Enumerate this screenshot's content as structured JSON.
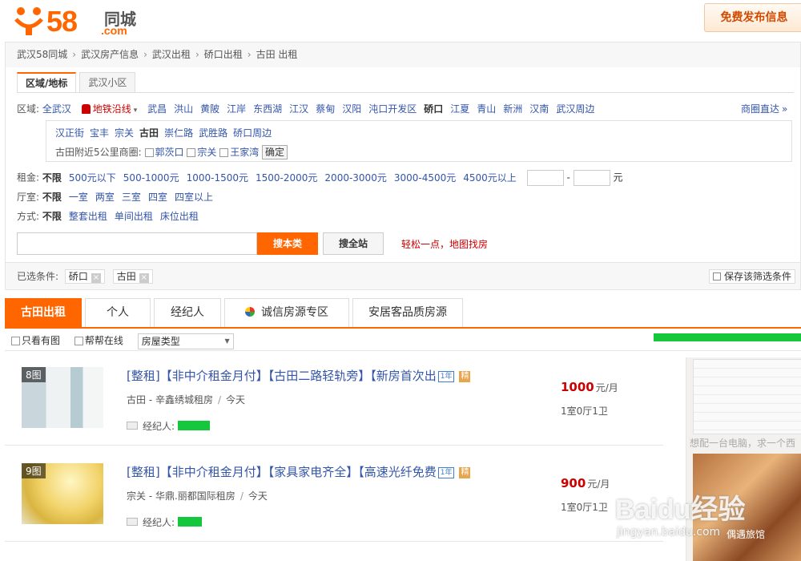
{
  "header": {
    "logo_num": "58",
    "logo_cn": "同城",
    "logo_domain": ".com",
    "post_button": "免费发布信息"
  },
  "breadcrumb": [
    "武汉58同城",
    "武汉房产信息",
    "武汉出租",
    "硚口出租",
    "古田 出租"
  ],
  "filter_tabs": [
    "区域/地标",
    "武汉小区"
  ],
  "region": {
    "label": "区域:",
    "all": "全武汉",
    "metro": "地铁沿线",
    "districts": [
      "武昌",
      "洪山",
      "黄陂",
      "江岸",
      "东西湖",
      "江汉",
      "蔡甸",
      "汉阳",
      "沌口开发区",
      "硚口",
      "江夏",
      "青山",
      "新洲",
      "汉南",
      "武汉周边"
    ],
    "selected_district": "硚口",
    "shortcut": "商圈直达"
  },
  "subarea": {
    "items": [
      "汉正街",
      "宝丰",
      "宗关",
      "古田",
      "崇仁路",
      "武胜路",
      "硚口周边"
    ],
    "selected": "古田",
    "nearby_label": "古田附近5公里商圈:",
    "nearby": [
      "郭茨口",
      "宗关",
      "王家湾"
    ],
    "confirm": "确定"
  },
  "rent": {
    "label": "租金:",
    "options": [
      "不限",
      "500元以下",
      "500-1000元",
      "1000-1500元",
      "1500-2000元",
      "2000-3000元",
      "3000-4500元",
      "4500元以上"
    ],
    "dash": "-",
    "unit": "元"
  },
  "layout": {
    "label": "厅室:",
    "options": [
      "不限",
      "一室",
      "两室",
      "三室",
      "四室",
      "四室以上"
    ]
  },
  "mode": {
    "label": "方式:",
    "options": [
      "不限",
      "整套出租",
      "单间出租",
      "床位出租"
    ]
  },
  "search": {
    "value": "",
    "btn_local": "搜本类",
    "btn_all": "搜全站",
    "map_link": "轻松一点，地图找房"
  },
  "selected": {
    "label": "已选条件:",
    "tags": [
      "硚口",
      "古田"
    ],
    "save": "保存该筛选条件"
  },
  "main_tabs": [
    "古田出租",
    "个人",
    "经纪人",
    "诚信房源专区",
    "安居客品质房源"
  ],
  "toolbar": {
    "only_photo": "只看有图",
    "online": "帮帮在线",
    "type_select": "房屋类型"
  },
  "listings": [
    {
      "photos": "8图",
      "title": "[整租]【非中介租金月付】【古田二路轻轨旁】【新房首次出",
      "year_badge": "1年",
      "fine_badge": "精",
      "area": "古田",
      "community": "辛鑫绣城租房",
      "time": "今天",
      "agent_label": "经纪人:",
      "price": "1000",
      "price_unit": "元/月",
      "rooms": "1室0厅1卫"
    },
    {
      "photos": "9图",
      "title": "[整租]【非中介租金月付】【家具家电齐全】【高速光纤免费",
      "year_badge": "1年",
      "fine_badge": "精",
      "area": "宗关",
      "community": "华鼎.丽都国际租房",
      "time": "今天",
      "agent_label": "经纪人:",
      "price": "900",
      "price_unit": "元/月",
      "rooms": "1室0厅1卫"
    }
  ],
  "ad": {
    "text1": "想配一台电脑，求一个西",
    "text2": "偶遇旅馆"
  },
  "watermark": {
    "brand": "Baidu经验",
    "url": "jingyan.baidu.com"
  },
  "colors": {
    "accent": "#ff6600",
    "link": "#3355aa",
    "price": "#cc0000"
  }
}
